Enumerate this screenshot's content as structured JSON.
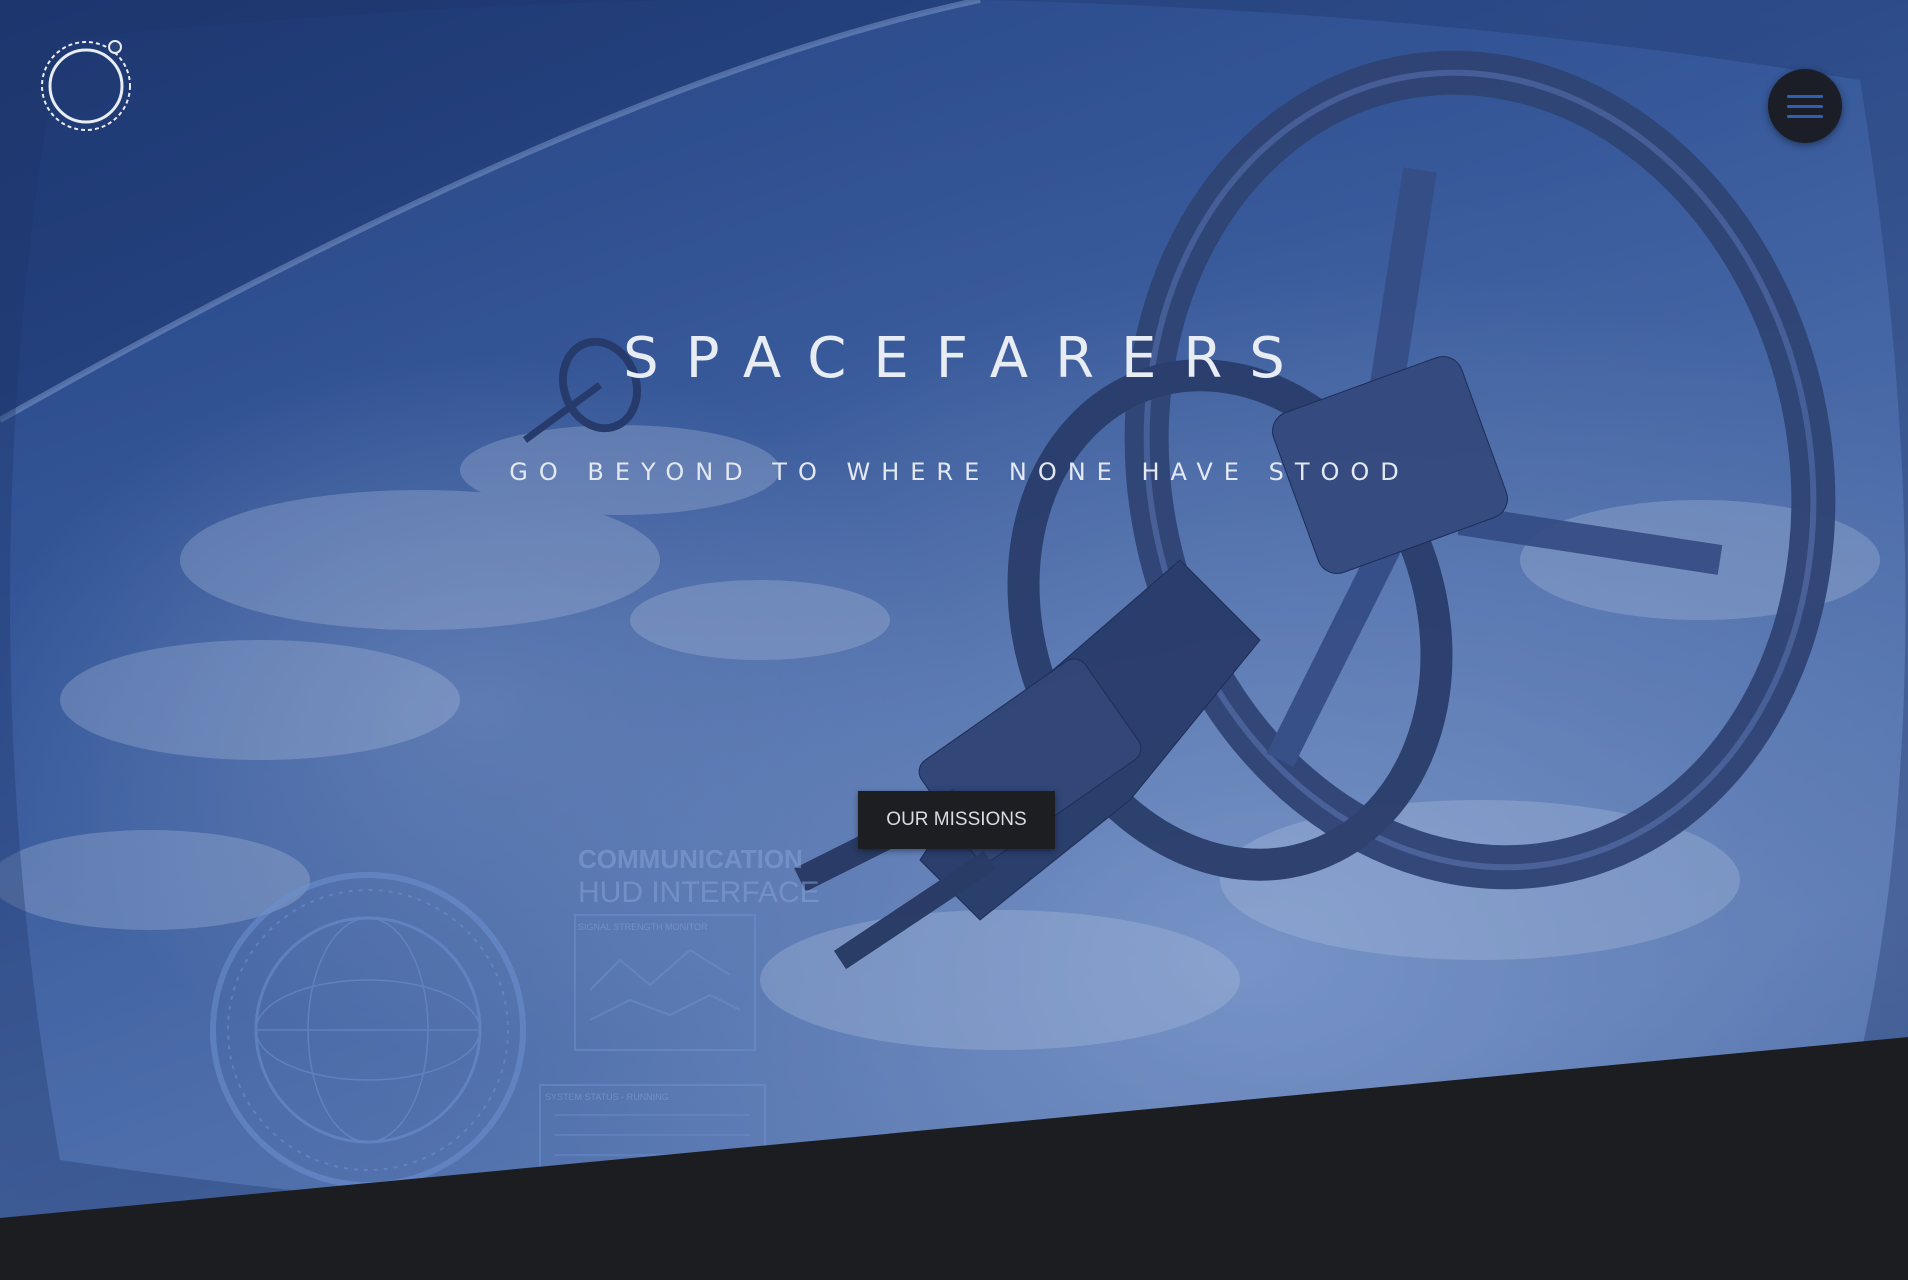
{
  "site": {
    "title": "SPACEFARERS",
    "tagline": "GO BEYOND TO WHERE NONE HAVE STOOD"
  },
  "header": {
    "logo_icon": "orbit-ring-icon",
    "menu_icon": "hamburger-menu-icon"
  },
  "hero": {
    "cta_label": "OUR MISSIONS",
    "background_image": "space-station-orbiting-earth",
    "hud_overlay": {
      "heading_line1": "COMMUNICATION",
      "heading_line2": "HUD INTERFACE",
      "panel1_label": "SIGNAL STRENGTH MONITOR",
      "panel2_label": "SYSTEM STATUS - RUNNING"
    }
  },
  "colors": {
    "hero_tint": "#3c5f9f",
    "dark_section": "#1c1d20",
    "menu_bar": "#2f5fb0",
    "text": "#e8ecf3"
  }
}
